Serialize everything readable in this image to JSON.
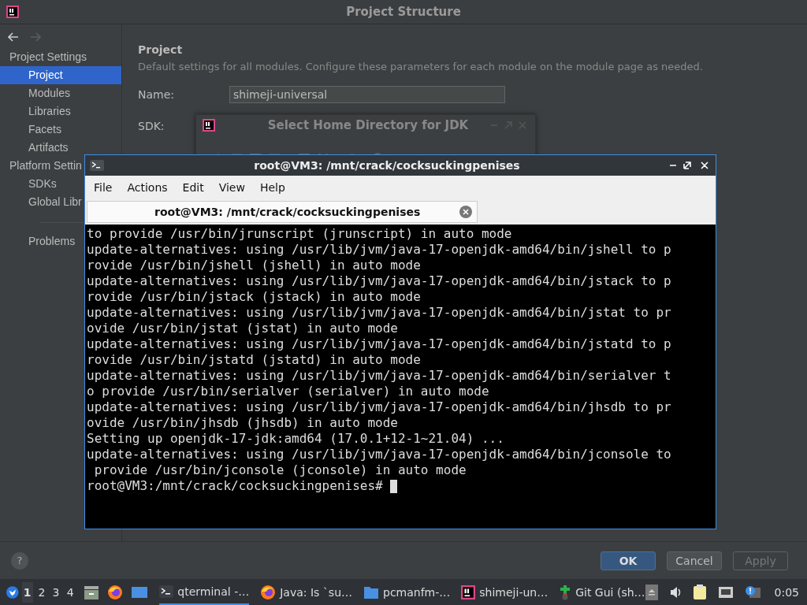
{
  "window": {
    "title": "Project Structure"
  },
  "sidebar": {
    "groups": [
      {
        "label": "Project Settings",
        "children": [
          {
            "label": "Project",
            "selected": true
          },
          {
            "label": "Modules",
            "selected": false
          },
          {
            "label": "Libraries",
            "selected": false
          },
          {
            "label": "Facets",
            "selected": false
          },
          {
            "label": "Artifacts",
            "selected": false
          }
        ]
      },
      {
        "label": "Platform Settin",
        "children": [
          {
            "label": "SDKs",
            "selected": false
          },
          {
            "label": "Global Libr",
            "selected": false
          }
        ]
      }
    ],
    "extra": [
      {
        "label": "Problems",
        "selected": false
      }
    ]
  },
  "content": {
    "heading": "Project",
    "description": "Default settings for all modules. Configure these parameters for each module on the module page as needed.",
    "name_label": "Name:",
    "name_value": "shimeji-universal",
    "sdk_label": "SDK:"
  },
  "jdk_dialog": {
    "title": "Select Home Directory for JDK"
  },
  "terminal": {
    "title": "root@VM3: /mnt/crack/cocksuckingpenises",
    "menu": [
      "File",
      "Actions",
      "Edit",
      "View",
      "Help"
    ],
    "tab": "root@VM3: /mnt/crack/cocksuckingpenises",
    "lines": [
      "to provide /usr/bin/jrunscript (jrunscript) in auto mode",
      "update-alternatives: using /usr/lib/jvm/java-17-openjdk-amd64/bin/jshell to p",
      "rovide /usr/bin/jshell (jshell) in auto mode",
      "update-alternatives: using /usr/lib/jvm/java-17-openjdk-amd64/bin/jstack to p",
      "rovide /usr/bin/jstack (jstack) in auto mode",
      "update-alternatives: using /usr/lib/jvm/java-17-openjdk-amd64/bin/jstat to pr",
      "ovide /usr/bin/jstat (jstat) in auto mode",
      "update-alternatives: using /usr/lib/jvm/java-17-openjdk-amd64/bin/jstatd to p",
      "rovide /usr/bin/jstatd (jstatd) in auto mode",
      "update-alternatives: using /usr/lib/jvm/java-17-openjdk-amd64/bin/serialver t",
      "o provide /usr/bin/serialver (serialver) in auto mode",
      "update-alternatives: using /usr/lib/jvm/java-17-openjdk-amd64/bin/jhsdb to pr",
      "ovide /usr/bin/jhsdb (jhsdb) in auto mode",
      "Setting up openjdk-17-jdk:amd64 (17.0.1+12-1~21.04) ...",
      "update-alternatives: using /usr/lib/jvm/java-17-openjdk-amd64/bin/jconsole to",
      " provide /usr/bin/jconsole (jconsole) in auto mode"
    ],
    "prompt": "root@VM3:/mnt/crack/cocksuckingpenises# "
  },
  "help": "?",
  "buttons": [
    {
      "label": "OK",
      "default": true,
      "disabled": false
    },
    {
      "label": "Cancel",
      "default": false,
      "disabled": false
    },
    {
      "label": "Apply",
      "default": false,
      "disabled": true
    }
  ],
  "taskbar": {
    "desktops": [
      {
        "label": "1",
        "selected": true
      },
      {
        "label": "2",
        "selected": false
      },
      {
        "label": "3",
        "selected": false
      },
      {
        "label": "4",
        "selected": false
      }
    ],
    "launchers": [
      {
        "kind": "files"
      },
      {
        "kind": "browser"
      },
      {
        "kind": "desktop"
      }
    ],
    "tasks": [
      {
        "kind": "terminal",
        "label": "qterminal -…",
        "selected": true
      },
      {
        "kind": "browser",
        "label": "Java: Is `su…",
        "selected": false
      },
      {
        "kind": "folder",
        "label": "pcmanfm-…",
        "selected": false
      },
      {
        "kind": "ide",
        "label": "shimeji-un…",
        "selected": false
      },
      {
        "kind": "git",
        "label": "Git Gui (sh…",
        "selected": false
      }
    ],
    "clock": "0:05"
  }
}
